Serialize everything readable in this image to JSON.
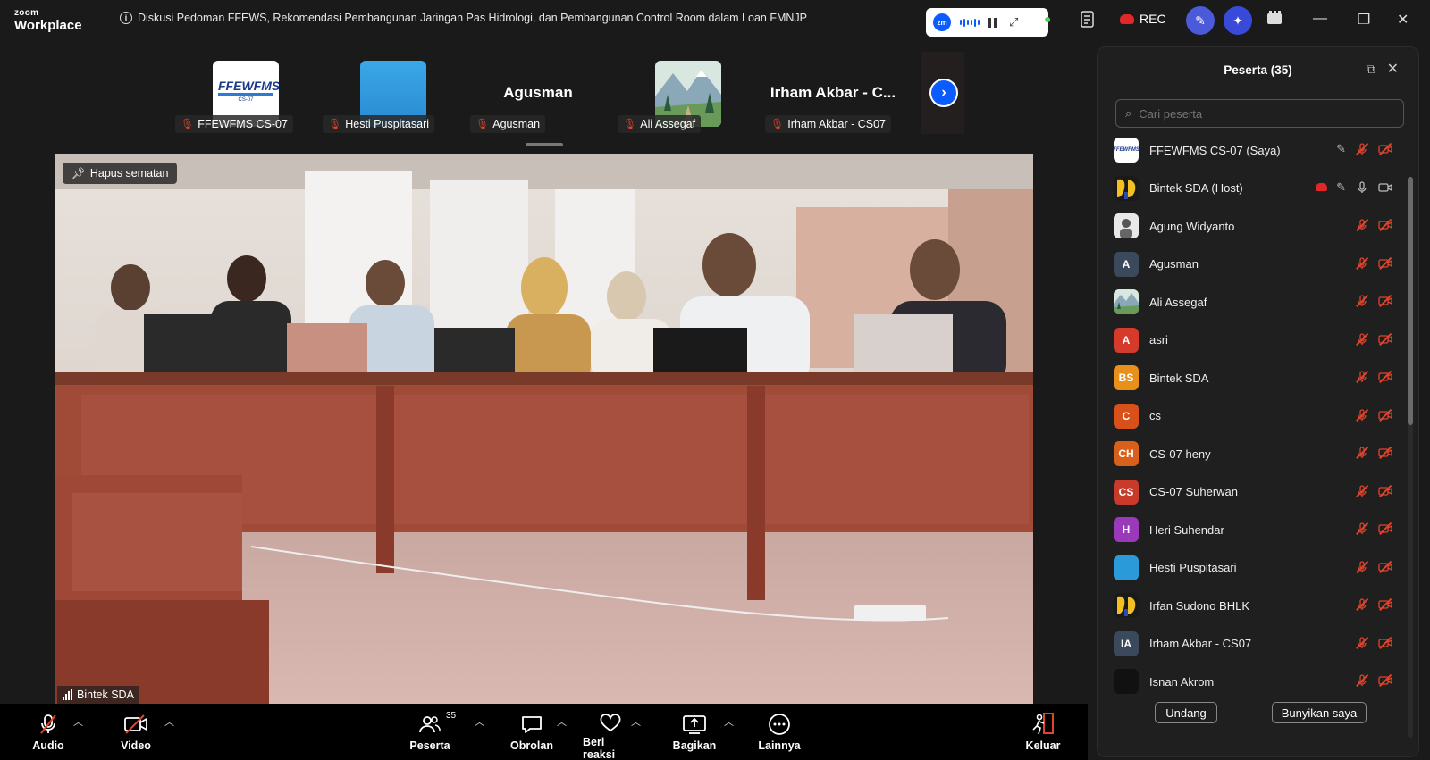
{
  "app": {
    "brand_top": "zoom",
    "brand_bottom": "Workplace"
  },
  "meeting": {
    "title": "Diskusi Pedoman FFEWS, Rekomendasi Pembangunan Jaringan Pas Hidrologi, dan Pembangunan Control Room dalam Loan FMNJP"
  },
  "mini_player": {
    "logo": "zm"
  },
  "header": {
    "rec_label": "REC"
  },
  "thumbnails": [
    {
      "name": "FFEWFMS CS-07",
      "logo_text": "FFEWFMS",
      "logo_sub": "CS-07",
      "type": "logo"
    },
    {
      "name": "Hesti Puspitasari",
      "type": "blue"
    },
    {
      "name": "Agusman",
      "display": "Agusman",
      "type": "text"
    },
    {
      "name": "Ali Assegaf",
      "type": "landscape"
    },
    {
      "name": "Irham Akbar - CS07",
      "display": "Irham Akbar - C...",
      "type": "text"
    }
  ],
  "video": {
    "pin_label": "Hapus sematan",
    "speaker_name": "Bintek SDA"
  },
  "toolbar": {
    "audio": "Audio",
    "video": "Video",
    "participants": "Peserta",
    "participants_count": "35",
    "chat": "Obrolan",
    "react": "Beri reaksi",
    "share": "Bagikan",
    "more": "Lainnya",
    "leave": "Keluar"
  },
  "panel": {
    "title": "Peserta (35)",
    "search_placeholder": "Cari peserta",
    "invite": "Undang",
    "unmute_me": "Bunyikan saya",
    "participants": [
      {
        "name": "FFEWFMS CS-07 (Saya)",
        "avatar": "FFEWFMS",
        "color": "#ffffff",
        "style": "logo",
        "edit": true,
        "mic": "off",
        "cam": "off"
      },
      {
        "name": "Bintek SDA (Host)",
        "avatar": "",
        "color": "#1a1a1a",
        "style": "pu",
        "cloud": true,
        "edit": true,
        "mic": "on",
        "cam": "on"
      },
      {
        "name": "Agung Widyanto",
        "avatar": "",
        "color": "#e8e8e8",
        "style": "photo",
        "mic": "off",
        "cam": "off"
      },
      {
        "name": "Agusman",
        "avatar": "A",
        "color": "#3a4a5c",
        "mic": "off",
        "cam": "off"
      },
      {
        "name": "Ali Assegaf",
        "avatar": "",
        "color": "#7a9a6a",
        "style": "landscape",
        "mic": "off",
        "cam": "off"
      },
      {
        "name": "asri",
        "avatar": "A",
        "color": "#d63a2a",
        "mic": "off",
        "cam": "off"
      },
      {
        "name": "Bintek SDA",
        "avatar": "BS",
        "color": "#e8901a",
        "mic": "off",
        "cam": "off"
      },
      {
        "name": "cs",
        "avatar": "C",
        "color": "#d8501a",
        "mic": "off",
        "cam": "off"
      },
      {
        "name": "CS-07 heny",
        "avatar": "CH",
        "color": "#d8601a",
        "mic": "off",
        "cam": "off"
      },
      {
        "name": "CS-07 Suherwan",
        "avatar": "CS",
        "color": "#c83a2a",
        "mic": "off",
        "cam": "off"
      },
      {
        "name": "Heri Suhendar",
        "avatar": "H",
        "color": "#9a3ab8",
        "mic": "off",
        "cam": "off"
      },
      {
        "name": "Hesti Puspitasari",
        "avatar": "",
        "color": "#2a9ad8",
        "mic": "off",
        "cam": "off"
      },
      {
        "name": "Irfan Sudono BHLK",
        "avatar": "",
        "color": "#1a1a1a",
        "style": "pu",
        "mic": "off",
        "cam": "off"
      },
      {
        "name": "Irham Akbar - CS07",
        "avatar": "IA",
        "color": "#3a4a5c",
        "mic": "off",
        "cam": "off"
      },
      {
        "name": "Isnan Akrom",
        "avatar": "",
        "color": "#111111",
        "mic": "off",
        "cam": "off"
      }
    ]
  }
}
